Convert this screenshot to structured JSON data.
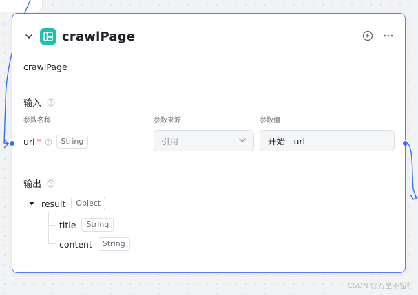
{
  "node": {
    "title": "crawlPage",
    "description": "crawlPage"
  },
  "input": {
    "section_title": "输入",
    "col_name": "参数名称",
    "col_source": "参数来源",
    "col_value": "参数值",
    "param": {
      "name": "url",
      "required_mark": "*",
      "type": "String",
      "source": "引用",
      "value": "开始 - url"
    }
  },
  "output": {
    "section_title": "输出",
    "root": {
      "name": "result",
      "type": "Object"
    },
    "children": [
      {
        "name": "title",
        "type": "String"
      },
      {
        "name": "content",
        "type": "String"
      }
    ]
  },
  "watermark": "CSDN @万里不留行",
  "colors": {
    "accent": "#3370ff",
    "node_icon": "#1cc1b1",
    "card_border": "#5b7cf2",
    "required": "#f54a45"
  },
  "icons": {
    "collapse": "chevron-down-icon",
    "node": "layout-icon",
    "run": "play-circle-icon",
    "more": "more-horizontal-icon",
    "help": "help-circle-icon",
    "expand": "caret-down-icon"
  }
}
